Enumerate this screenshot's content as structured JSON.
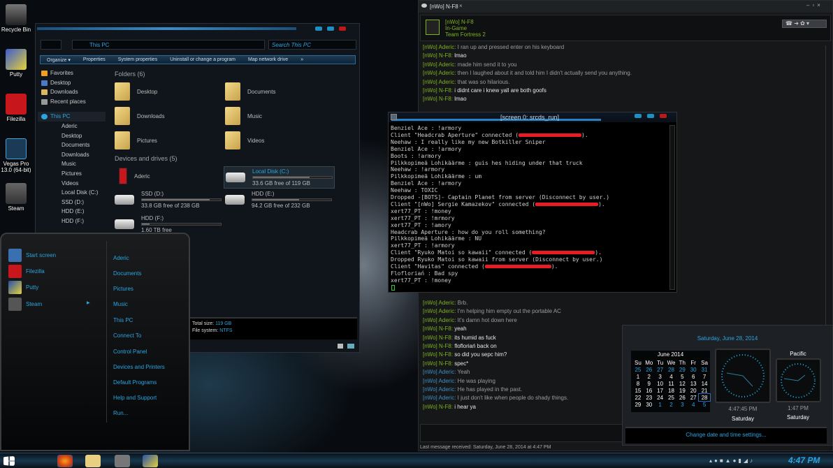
{
  "desktop": {
    "icons": [
      {
        "label": "Recycle Bin",
        "icon": "recycle-bin-icon"
      },
      {
        "label": "Putty",
        "icon": "putty-icon"
      },
      {
        "label": "Filezilla",
        "icon": "filezilla-icon"
      },
      {
        "label": "Vegas Pro 13.0 (64-bit)",
        "icon": "vegas-icon"
      },
      {
        "label": "Steam",
        "icon": "steam-icon"
      }
    ]
  },
  "explorer": {
    "address": "This PC",
    "search_placeholder": "Search This PC",
    "toolbar": [
      "Organize ▾",
      "Properties",
      "System properties",
      "Uninstall or change a program",
      "Map network drive",
      "»"
    ],
    "nav": {
      "favorites_label": "Favorites",
      "favorites": [
        "Desktop",
        "Downloads",
        "Recent places"
      ],
      "thispc_label": "This PC",
      "thispc": [
        "Aderic",
        "Desktop",
        "Documents",
        "Downloads",
        "Music",
        "Pictures",
        "Videos",
        "Local Disk (C:)",
        "SSD (D:)",
        "HDD (E:)",
        "HDD (F:)"
      ]
    },
    "folders_header": "Folders (6)",
    "folders": [
      "Desktop",
      "Documents",
      "Downloads",
      "Music",
      "Pictures",
      "Videos"
    ],
    "drives_header": "Devices and drives (5)",
    "drives": [
      {
        "name": "Aderic",
        "free": ""
      },
      {
        "name": "Local Disk (C:)",
        "free": "33.6 GB free of 119 GB",
        "used_pct": 72
      },
      {
        "name": "SSD (D:)",
        "free": "33.8 GB free of 238 GB",
        "used_pct": 86
      },
      {
        "name": "HDD (E:)",
        "free": "94.2 GB free of 232 GB",
        "used_pct": 59
      },
      {
        "name": "HDD (F:)",
        "free": "1.60 TB free",
        "used_pct": 10
      }
    ],
    "details": {
      "total_label": "Total size:",
      "total": "119 GB",
      "fs_label": "File system:",
      "fs": "NTFS"
    }
  },
  "chat": {
    "tab": "[nWo] N-F8",
    "name": "[nWo] N-F8",
    "status": "In-Game",
    "game": "Team Fortress 2",
    "messages_top": [
      {
        "from": "[nWo] Aderic:",
        "text": "I ran up and pressed enter on his keyboard",
        "me": false
      },
      {
        "from": "[nWo] N-F8:",
        "text": "lmao",
        "me": true
      },
      {
        "from": "[nWo] Aderic:",
        "text": "made him send it to you",
        "me": false
      },
      {
        "from": "[nWo] Aderic:",
        "text": "then I laughed about it and told him I didn't actually send you anything.",
        "me": false
      },
      {
        "from": "[nWo] Aderic:",
        "text": "that was so hilarious.",
        "me": false
      },
      {
        "from": "[nWo] N-F8:",
        "text": "i didnt care i knew yall are both goofs",
        "me": true
      },
      {
        "from": "[nWo] N-F8:",
        "text": "lmao",
        "me": true
      }
    ],
    "messages_bottom": [
      {
        "from": "[nWo] Aderic:",
        "text": "Brb.",
        "me": false
      },
      {
        "from": "[nWo] Aderic:",
        "text": "I'm helping him empty out the portable AC",
        "me": false
      },
      {
        "from": "[nWo] Aderic:",
        "text": "It's damn hot down here",
        "me": false
      },
      {
        "from": "[nWo] N-F8:",
        "text": "yeah",
        "me": true
      },
      {
        "from": "[nWo] N-F8:",
        "text": "its humid as fuck",
        "me": true
      },
      {
        "from": "[nWo] N-F8:",
        "text": "flofloriań back on",
        "me": true
      },
      {
        "from": "[nWo] N-F8:",
        "text": "so did you sepc him?",
        "me": true
      },
      {
        "from": "[nWo] N-F8:",
        "text": "spec*",
        "me": true
      },
      {
        "from": "[nWo] Aderic:",
        "text": "Yeah",
        "me": false,
        "blue": true
      },
      {
        "from": "[nWo] Aderic:",
        "text": "He was playing",
        "me": false,
        "blue": true
      },
      {
        "from": "[nWo] Aderic:",
        "text": "He has played in the past.",
        "me": false,
        "blue": true
      },
      {
        "from": "[nWo] Aderic:",
        "text": "I just don't like when people do shady things.",
        "me": false,
        "blue": true
      },
      {
        "from": "[nWo] N-F8:",
        "text": "i hear ya",
        "me": true
      }
    ],
    "last_message": "Last message received: Saturday, June 28, 2014 at 4:47 PM"
  },
  "terminal": {
    "title": "[screen 0: srcds_run]",
    "lines": [
      {
        "text": "Benziel Ace : !armory"
      },
      {
        "text": "Client \"Headcrab Aperture\" connected (",
        "redact": true,
        "end": ")."
      },
      {
        "text": "Neehaw : I really like my new Botkiller Sniper"
      },
      {
        "text": "Benziel Ace : !armory"
      },
      {
        "text": "Boots : !armory"
      },
      {
        "text": "Pilkkopimeä Lohikäärme : guis hes hiding under that truck"
      },
      {
        "text": "Neehaw : !armory"
      },
      {
        "text": "Pilkkopimeä Lohikäärme : um"
      },
      {
        "text": "Benziel Ace : !armory"
      },
      {
        "text": "Neehaw : TOXIC"
      },
      {
        "text": "Dropped -[BOTS]- Captain Planet from server (Disconnect by user.)"
      },
      {
        "text": "Client \"[nWo] Sergie Kamazekov\" connected (",
        "redact": true,
        "end": ")."
      },
      {
        "text": "xert77_PT : !money"
      },
      {
        "text": "xert77_PT : !mrmory"
      },
      {
        "text": "xert77_PT : !amory"
      },
      {
        "text": "Headcrab Aperture : how do you roll something?"
      },
      {
        "text": "Pilkkopimeä Lohikäärme : NU"
      },
      {
        "text": "xert77_PT : !armory"
      },
      {
        "text": "Client \"Ryuko Matoi so kawaii\" connected (",
        "redact": true,
        "end": ")."
      },
      {
        "text": "Dropped Ryuko Matoi so kawaii from server (Disconnect by user.)"
      },
      {
        "text": "Client \"Havitas\" connected (",
        "redact": true,
        "end": ")."
      },
      {
        "text": "Flofloriań : Bad spy"
      },
      {
        "text": "xert77_PT : !money"
      }
    ]
  },
  "clock": {
    "date": "Saturday, June 28, 2014",
    "month": "June 2014",
    "weekdays": [
      "Su",
      "Mo",
      "Tu",
      "We",
      "Th",
      "Fr",
      "Sa"
    ],
    "weeks": [
      [
        "25",
        "26",
        "27",
        "28",
        "29",
        "30",
        "31"
      ],
      [
        "1",
        "2",
        "3",
        "4",
        "5",
        "6",
        "7"
      ],
      [
        "8",
        "9",
        "10",
        "11",
        "12",
        "13",
        "14"
      ],
      [
        "15",
        "16",
        "17",
        "18",
        "19",
        "20",
        "21"
      ],
      [
        "22",
        "23",
        "24",
        "25",
        "26",
        "27",
        "28"
      ],
      [
        "29",
        "30",
        "1",
        "2",
        "3",
        "4",
        "5"
      ]
    ],
    "selected": "28",
    "local_time": "4:47:45 PM",
    "local_day": "Saturday",
    "pacific_label": "Pacific",
    "pacific_time": "1:47 PM",
    "pacific_day": "Saturday",
    "settings_link": "Change date and time settings..."
  },
  "start_menu": {
    "left": [
      {
        "label": "Start screen",
        "color": "#3a6fb0"
      },
      {
        "label": "Filezilla",
        "color": "#c8161d"
      },
      {
        "label": "Putty",
        "color": "#2850a8"
      },
      {
        "label": "Steam",
        "color": "#555"
      }
    ],
    "right": [
      "Aderic",
      "Documents",
      "Pictures",
      "Music",
      "This PC",
      "Connect To",
      "Control Panel",
      "Devices and Printers",
      "Default Programs",
      "Help and Support",
      "Run..."
    ]
  },
  "taskbar": {
    "time": "4:47 PM"
  },
  "colors": {
    "accent": "#2aa5e0",
    "chat_green": "#7fb21e",
    "chat_blue": "#3e8fc4",
    "redaction": "#e81c24"
  }
}
